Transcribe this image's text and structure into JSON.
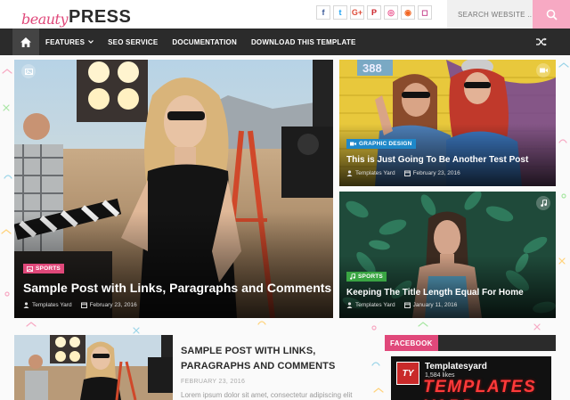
{
  "header": {
    "logo_script": "beauty",
    "logo_bold": "PRESS",
    "social": [
      {
        "icon": "facebook-icon",
        "glyph": "f",
        "color": "#3b5998"
      },
      {
        "icon": "twitter-icon",
        "glyph": "t",
        "color": "#1da1f2"
      },
      {
        "icon": "google-plus-icon",
        "glyph": "G+",
        "color": "#dd4b39"
      },
      {
        "icon": "pinterest-icon",
        "glyph": "P",
        "color": "#cb2027"
      },
      {
        "icon": "dribbble-icon",
        "glyph": "◎",
        "color": "#ea4c89"
      },
      {
        "icon": "rss-icon",
        "glyph": "◉",
        "color": "#f26522"
      },
      {
        "icon": "instagram-icon",
        "glyph": "◻",
        "color": "#c13584"
      }
    ],
    "search_placeholder": "SEARCH WEBSITE ..."
  },
  "nav": {
    "items": [
      {
        "label": "FEATURES",
        "has_dropdown": true
      },
      {
        "label": "SEO SERVICE"
      },
      {
        "label": "DOCUMENTATION"
      },
      {
        "label": "DOWNLOAD THIS TEMPLATE"
      }
    ]
  },
  "featured": [
    {
      "category": "SPORTS",
      "category_color": "#e0487a",
      "title": "Sample Post with Links, Paragraphs and Comments",
      "author": "Templates Yard",
      "date": "February 23, 2016",
      "format_icon": "image-icon"
    },
    {
      "category": "GRAPHIC DESIGN",
      "category_color": "#1e88c9",
      "title": "This is Just Going To Be Another Test Post",
      "author": "Templates Yard",
      "date": "February 23, 2016",
      "format_icon": "video-icon"
    },
    {
      "category": "SPORTS",
      "category_color": "#3aa543",
      "title": "Keeping The Title Length Equal For Home",
      "author": "Templates Yard",
      "date": "January 11, 2016",
      "format_icon": "music-icon"
    }
  ],
  "latest_post": {
    "title": "SAMPLE POST WITH LINKS, PARAGRAPHS AND COMMENTS",
    "date": "FEBRUARY 23, 2016",
    "excerpt": "Lorem ipsum dolor sit amet, consectetur adipiscing elit"
  },
  "sidebar": {
    "widget_title": "FACEBOOK",
    "page_name": "Templatesyard",
    "likes": "1,584 likes",
    "avatar_text": "TY",
    "brand_text": "TEMPLATES YARD"
  },
  "colors": {
    "accent": "#e0487a",
    "nav_bg": "#2b2b2b"
  }
}
